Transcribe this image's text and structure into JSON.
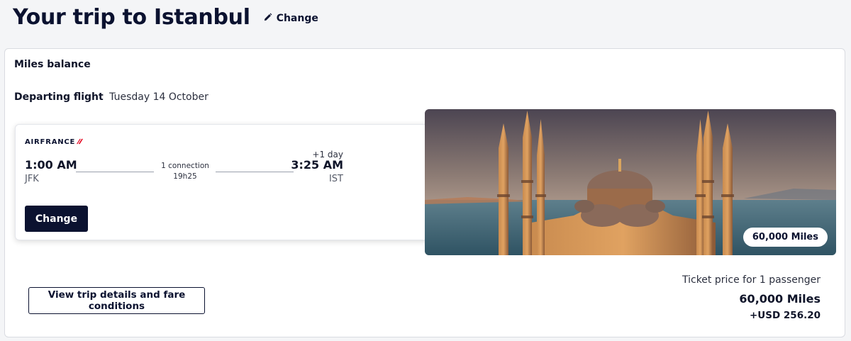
{
  "header": {
    "title": "Your trip to Istanbul",
    "change_label": "Change",
    "change_icon": "pencil-icon"
  },
  "summary": {
    "miles_balance_label": "Miles balance",
    "departing_label": "Departing flight",
    "departing_date": "Tuesday 14 October"
  },
  "flight": {
    "airline": "AIRFRANCE",
    "airline_mark": "✓",
    "departure_time": "1:00 AM",
    "departure_airport": "JFK",
    "connections": "1 connection",
    "duration": "19h25",
    "day_offset": "+1 day",
    "arrival_time": "3:25 AM",
    "arrival_airport": "IST",
    "change_button": "Change"
  },
  "destination": {
    "image_icon": "istanbul-mosque-photo",
    "miles_badge": "60,000 Miles"
  },
  "actions": {
    "details_button": "View trip details and fare conditions"
  },
  "price": {
    "label": "Ticket price for 1 passenger",
    "miles": "60,000 Miles",
    "usd": "+USD 256.20"
  },
  "colors": {
    "brand_navy": "#0b1230",
    "airline_red": "#e3001b",
    "page_bg": "#f4f5f7"
  }
}
